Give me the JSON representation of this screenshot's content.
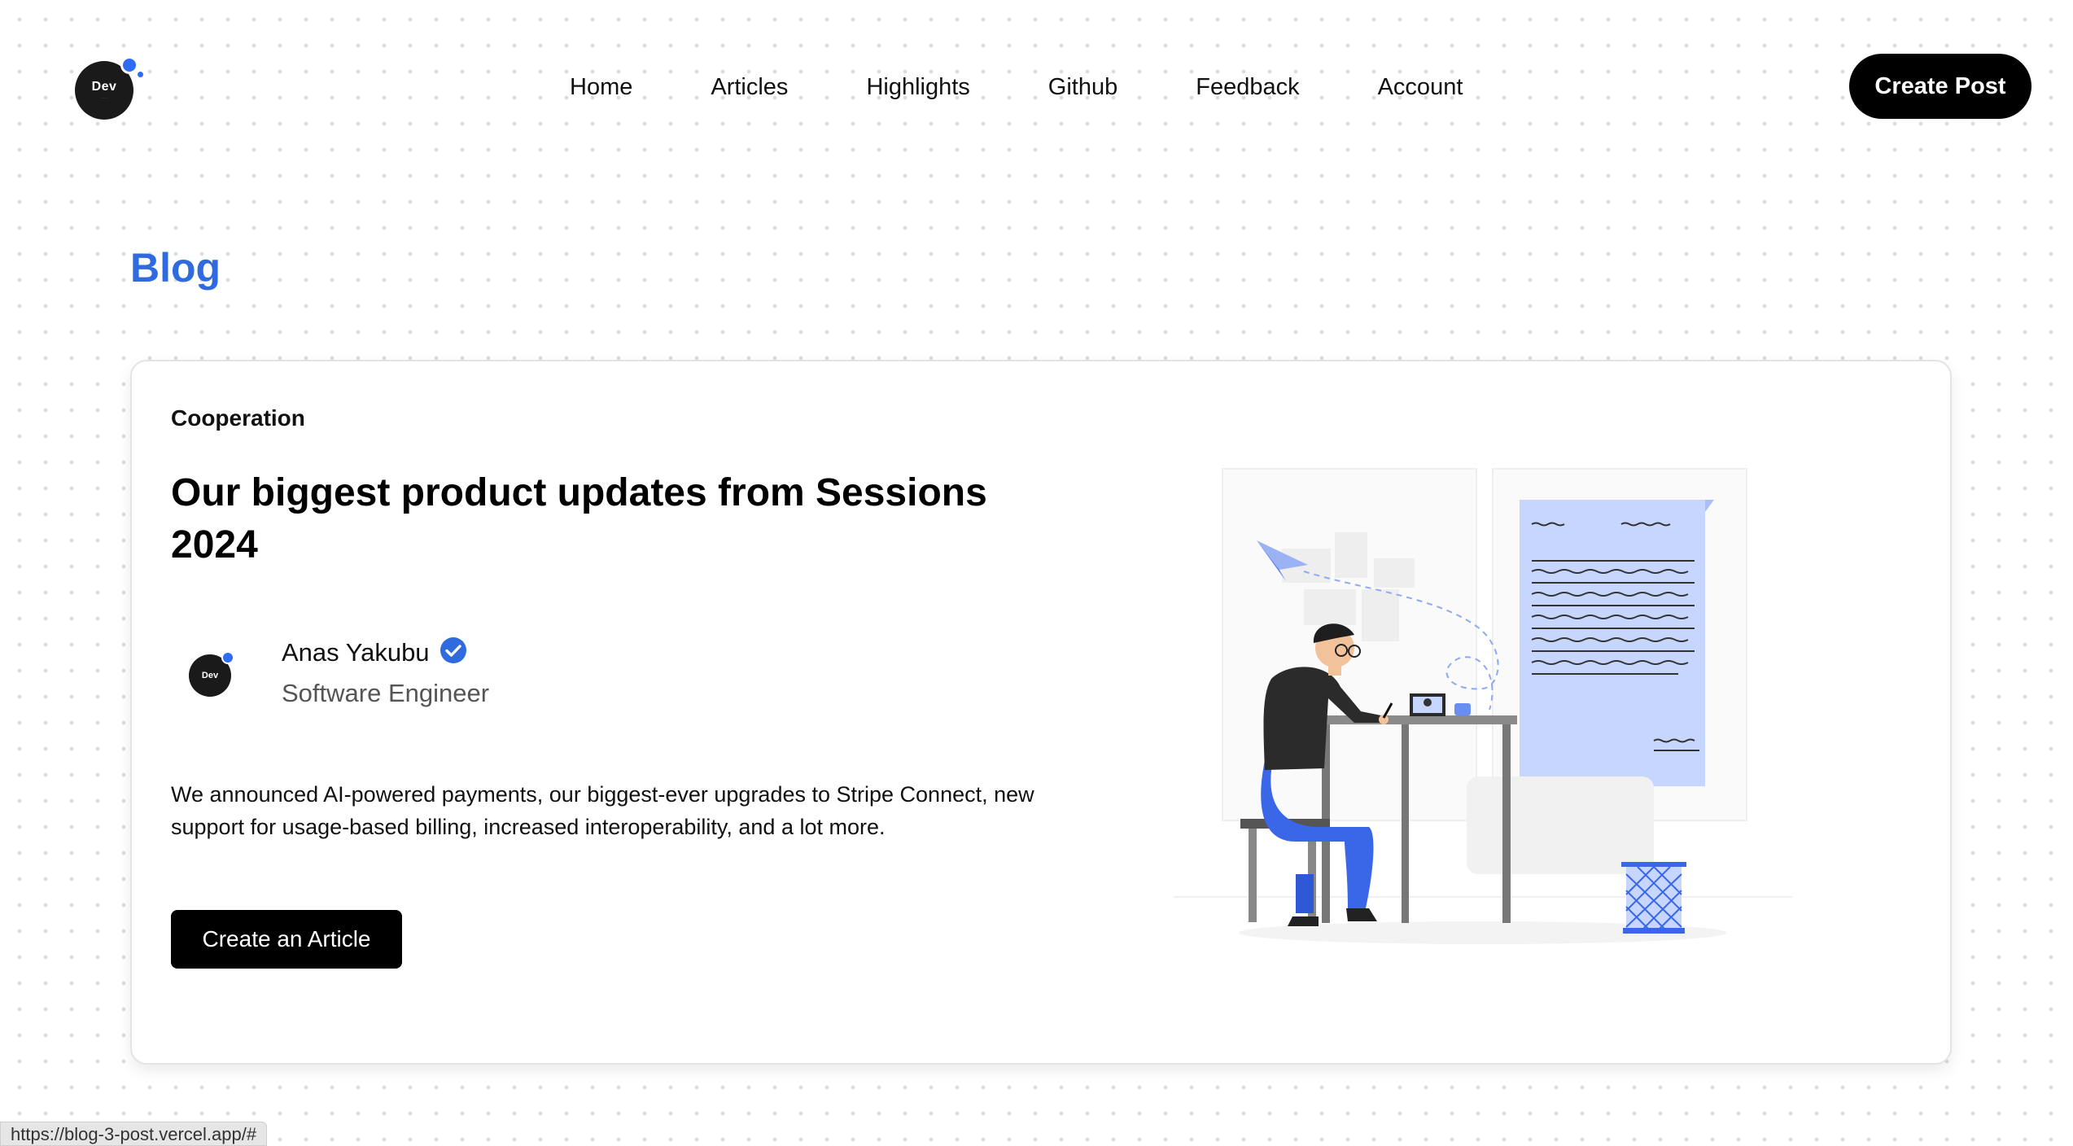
{
  "logo": {
    "text": "Dev",
    "subtext": "· · ·"
  },
  "nav": {
    "items": [
      "Home",
      "Articles",
      "Highlights",
      "Github",
      "Feedback",
      "Account"
    ]
  },
  "header": {
    "create_post_label": "Create Post"
  },
  "page": {
    "title": "Blog"
  },
  "post": {
    "category": "Cooperation",
    "title": "Our biggest product updates from Sessions 2024",
    "author": {
      "avatar_text": "Dev",
      "name": "Anas Yakubu",
      "role": "Software Engineer",
      "verified": true
    },
    "excerpt": "We announced AI-powered payments, our biggest-ever upgrades to Stripe Connect, new support for usage-based billing, increased interoperability, and a lot more.",
    "cta_label": "Create an Article"
  },
  "status_bar": {
    "url": "https://blog-3-post.vercel.app/#"
  },
  "colors": {
    "accent": "#2f6bdf",
    "illustration_blue": "#3a66e8",
    "paper": "#c7d6ff"
  }
}
